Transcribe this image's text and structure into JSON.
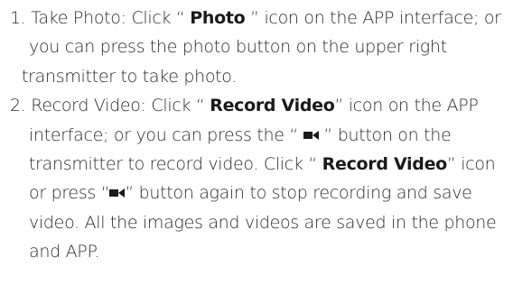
{
  "step1": {
    "l1_pre": "1. Take Photo: Click “ ",
    "l1_bold": "Photo",
    "l1_post": " ” icon on the APP interface; or",
    "l2": "you can press the photo button on the upper right",
    "l3": "transmitter to take photo."
  },
  "step2": {
    "l1_pre": "2. Record Video: Click “ ",
    "l1_bold": "Record Video",
    "l1_post": "” icon on the APP",
    "l2_pre": "interface; or you can press the “ ",
    "l2_post": " ” button on the",
    "l3_pre": "transmitter to record video.  Click “ ",
    "l3_bold": "Record Video",
    "l3_post": "” icon",
    "l4_pre": "or press “",
    "l4_post": "” button again to stop recording and save",
    "l5": "video. All the images and videos are saved in the phone",
    "l6": "and APP."
  },
  "icons": {
    "record_icon": "video-camera-icon"
  }
}
